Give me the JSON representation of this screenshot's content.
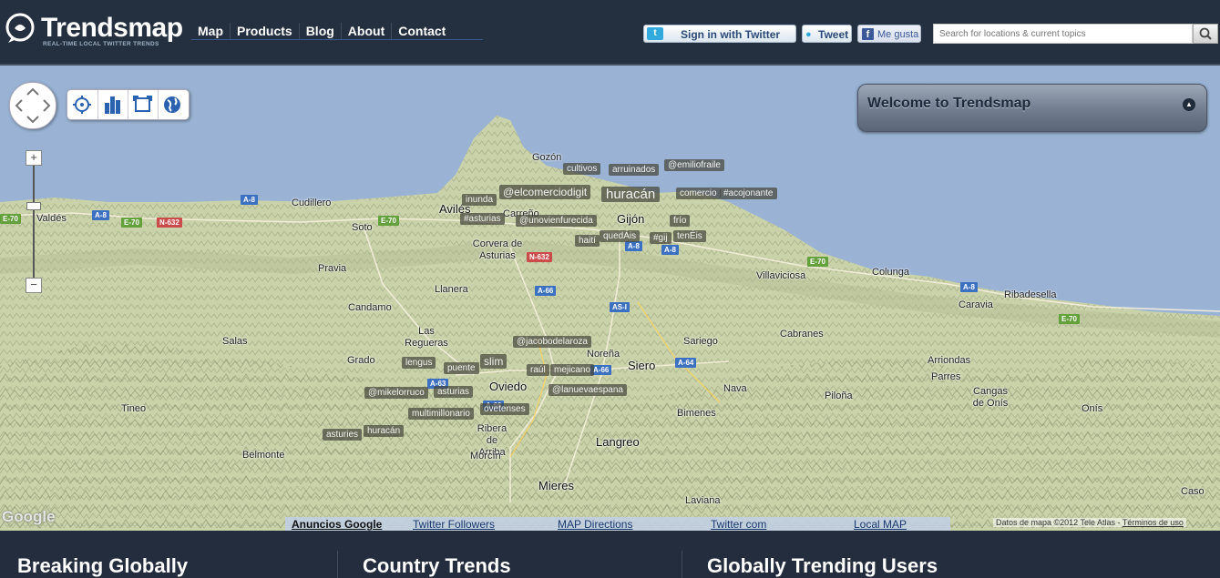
{
  "logo": {
    "name": "Trendsmap",
    "tagline": "REAL-TIME LOCAL TWITTER TRENDS"
  },
  "nav": [
    "Map",
    "Products",
    "Blog",
    "About",
    "Contact"
  ],
  "header_buttons": {
    "signin": "Sign in with Twitter",
    "tweet": "Tweet",
    "like": "Me gusta"
  },
  "search": {
    "placeholder": "Search for locations & current topics"
  },
  "welcome": {
    "title": "Welcome to Trendsmap"
  },
  "zoom": {
    "plus": "+",
    "minus": "−"
  },
  "tags": [
    {
      "text": "cultivos"
    },
    {
      "text": "arruinados"
    },
    {
      "text": "@emiliofraile"
    },
    {
      "text": "inunda"
    },
    {
      "text": "@elcomerciodigit"
    },
    {
      "text": "huracán"
    },
    {
      "text": "comercio"
    },
    {
      "text": "#acojonante"
    },
    {
      "text": "#asturias"
    },
    {
      "text": "@unovienfurecida"
    },
    {
      "text": "frío"
    },
    {
      "text": "haití"
    },
    {
      "text": "quedÁis"
    },
    {
      "text": "#gij"
    },
    {
      "text": "tenÉis"
    },
    {
      "text": "@jacobodelaroza"
    },
    {
      "text": "slim"
    },
    {
      "text": "lengus"
    },
    {
      "text": "puente"
    },
    {
      "text": "raúl"
    },
    {
      "text": "mejicano"
    },
    {
      "text": "@mikelorruco"
    },
    {
      "text": "asturias"
    },
    {
      "text": "@lanuevaespana"
    },
    {
      "text": "multimillonario"
    },
    {
      "text": "ovetenses"
    },
    {
      "text": "asturies"
    },
    {
      "text": "huracán"
    }
  ],
  "places": [
    "Gozón",
    "Avilés",
    "Cudillero",
    "Carreño",
    "Gijón",
    "Valdés",
    "Soto",
    "Corvera de Asturias",
    "Pravia",
    "Llanera",
    "Villaviciosa",
    "Colunga",
    "Caravia",
    "Ribadesella",
    "Candamo",
    "Las Regueras",
    "Noreña",
    "Sariego",
    "Cabranes",
    "Salas",
    "Grado",
    "Siero",
    "Oviedo",
    "Nava",
    "Piloña",
    "Arriondas",
    "Parres",
    "Cangas de Onís",
    "Tineo",
    "Ribera de Arriba",
    "Bimenes",
    "Langreo",
    "Belmonte",
    "Morcín",
    "Mieres",
    "Laviana",
    "Onís",
    "Caso"
  ],
  "roads": [
    "A-8",
    "E-70",
    "N-632",
    "E-70",
    "A-8",
    "N-632",
    "A-8",
    "E-70",
    "A-66",
    "AS-I",
    "A-8",
    "A-64",
    "A-63",
    "A-66",
    "A-66",
    "E-70",
    "E-70"
  ],
  "ad_links": [
    "Anuncios Google",
    "Twitter Followers",
    "MAP Directions",
    "Twitter com",
    "Local MAP"
  ],
  "attribution": {
    "text": "Datos de mapa ©2012 Tele Atlas - ",
    "terms": "Términos de uso"
  },
  "google_logo": "Google",
  "columns": [
    "Breaking Globally",
    "Country Trends",
    "Globally Trending Users"
  ],
  "colors": {
    "sea": "#9ab3d4",
    "land": "#c9d2a8",
    "header": "#24303f",
    "tag_bg": "#46463c"
  }
}
